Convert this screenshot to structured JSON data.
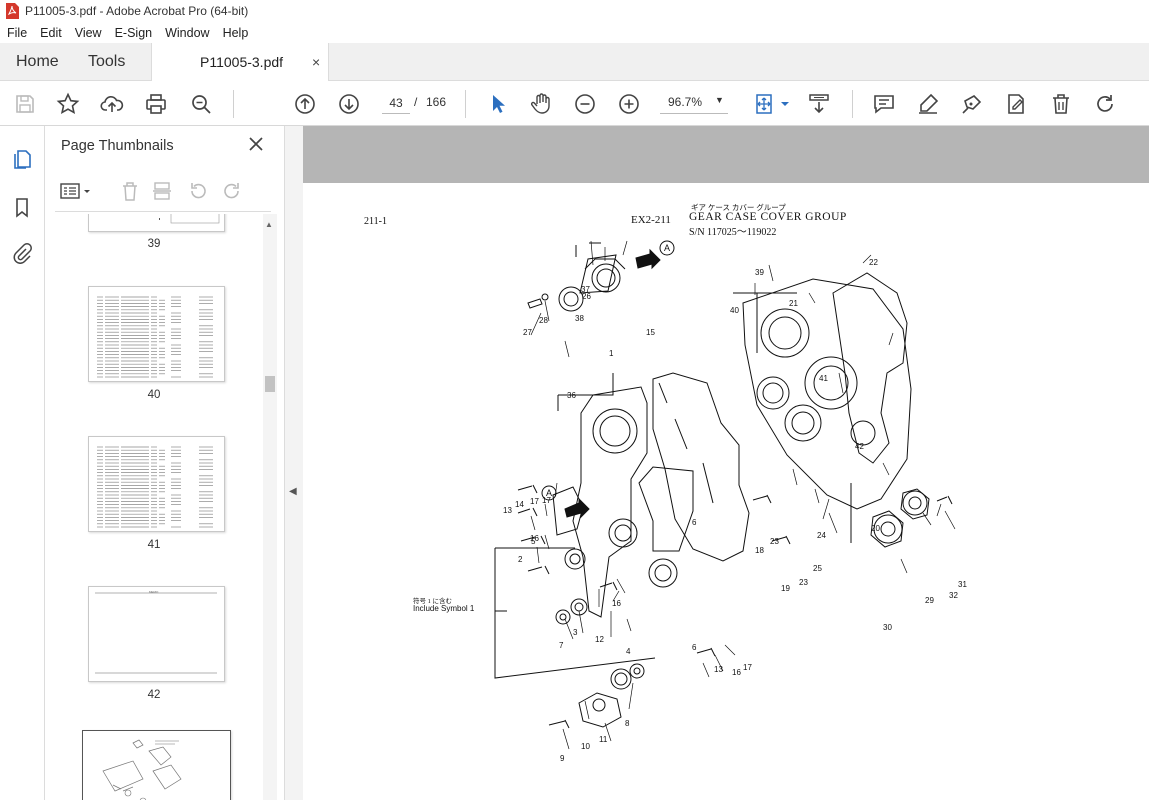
{
  "window": {
    "title": "P11005-3.pdf - Adobe Acrobat Pro (64-bit)"
  },
  "menu": [
    "File",
    "Edit",
    "View",
    "E-Sign",
    "Window",
    "Help"
  ],
  "tabs": {
    "home": "Home",
    "tools": "Tools",
    "document": "P11005-3.pdf",
    "close": "×"
  },
  "toolbar": {
    "page_current": "43",
    "page_separator": "/",
    "page_total": "166",
    "zoom": "96.7%",
    "icons": [
      "save-icon",
      "star-icon",
      "upload-icon",
      "print-icon",
      "search-zoom-icon",
      "page-up-icon",
      "page-down-icon",
      "select-cursor-icon",
      "hand-icon",
      "zoom-out-icon",
      "zoom-in-icon",
      "fit-page-icon",
      "scroll-mode-icon",
      "comment-icon",
      "highlight-icon",
      "sign-icon",
      "edit-pdf-icon",
      "delete-icon",
      "rotate-icon"
    ]
  },
  "panel": {
    "title": "Page Thumbnails",
    "thumbnails": [
      {
        "label": "39"
      },
      {
        "label": "40"
      },
      {
        "label": "41"
      },
      {
        "label": "42"
      },
      {
        "label": ""
      }
    ]
  },
  "document": {
    "page_code": "211-1",
    "model_code": "EX2-211",
    "title_jp": "ギア ケース カバー グループ",
    "title_en": "GEAR CASE COVER GROUP",
    "serial": "S/N 117025～119022",
    "note_jp": "符号 1 に含む",
    "note_en": "Include Symbol 1",
    "callout_a": "A",
    "part_numbers": [
      "1",
      "2",
      "3",
      "4",
      "5",
      "6",
      "6",
      "7",
      "8",
      "9",
      "10",
      "11",
      "13",
      "13",
      "14",
      "15",
      "16",
      "16",
      "16",
      "17",
      "17",
      "17",
      "18",
      "19",
      "20",
      "21",
      "22",
      "23",
      "23",
      "24",
      "25",
      "26",
      "27",
      "28",
      "29",
      "30",
      "31",
      "32",
      "36",
      "37",
      "38",
      "39",
      "40",
      "41",
      "42",
      "12"
    ]
  },
  "colors": {
    "accent": "#2c6fbf",
    "acrobat_red": "#d4382c",
    "page_gray": "#b5b5b5"
  }
}
